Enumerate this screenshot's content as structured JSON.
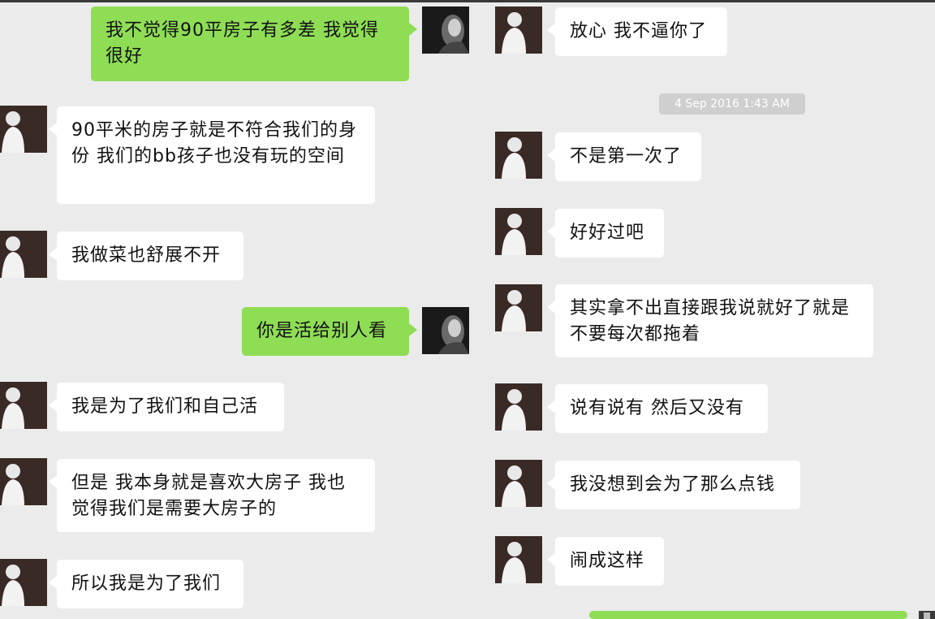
{
  "timestamp": "4 Sep 2016 1:43 AM",
  "colors": {
    "outgoing_bubble": "#8fdd55",
    "incoming_bubble": "#ffffff",
    "background": "#ebebeb"
  },
  "left_messages": [
    {
      "sender": "self",
      "text": "我不觉得90平房子有多差 我觉得很好"
    },
    {
      "sender": "contact",
      "text": "90平米的房子就是不符合我们的身份 我们的bb孩子也没有玩的空间"
    },
    {
      "sender": "contact",
      "text": "我做菜也舒展不开"
    },
    {
      "sender": "self",
      "text": "你是活给别人看"
    },
    {
      "sender": "contact",
      "text": "我是为了我们和自己活"
    },
    {
      "sender": "contact",
      "text": "但是 我本身就是喜欢大房子 我也觉得我们是需要大房子的"
    },
    {
      "sender": "contact",
      "text": "所以我是为了我们"
    }
  ],
  "right_messages": [
    {
      "sender": "contact",
      "text": "放心 我不逼你了"
    },
    {
      "sender": "contact",
      "text": "不是第一次了"
    },
    {
      "sender": "contact",
      "text": "好好过吧"
    },
    {
      "sender": "contact",
      "text": "其实拿不出直接跟我说就好了就是不要每次都拖着"
    },
    {
      "sender": "contact",
      "text": "说有说有 然后又没有"
    },
    {
      "sender": "contact",
      "text": "我没想到会为了那么点钱"
    },
    {
      "sender": "contact",
      "text": "闹成这样"
    },
    {
      "sender": "self",
      "text": ""
    }
  ]
}
